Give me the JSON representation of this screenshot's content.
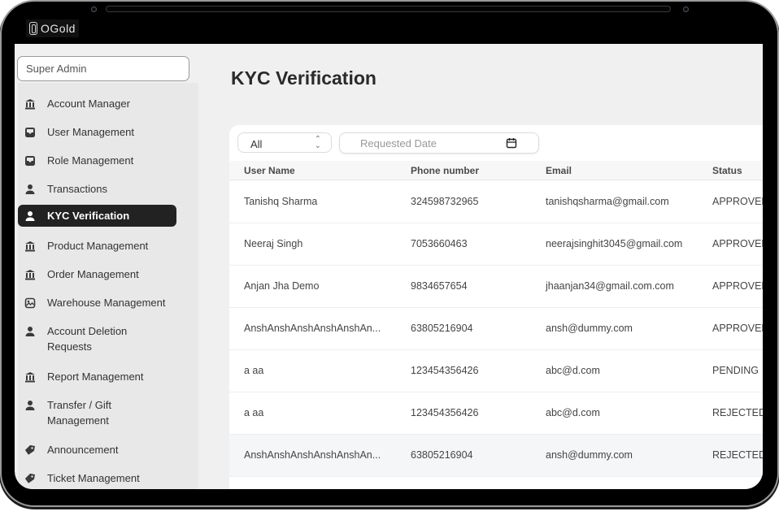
{
  "app": {
    "brand": "OGold",
    "role": "Super Admin"
  },
  "sidebar": {
    "items": [
      {
        "label": "Account Manager",
        "icon": "bank-icon"
      },
      {
        "label": "User Management",
        "icon": "inbox-icon"
      },
      {
        "label": "Role Management",
        "icon": "inbox-icon"
      },
      {
        "label": "Transactions",
        "icon": "person-icon"
      },
      {
        "label": "KYC Verification",
        "icon": "person-icon",
        "active": true
      },
      {
        "label": "Product Management",
        "icon": "bank-icon"
      },
      {
        "label": "Order Management",
        "icon": "bank-icon"
      },
      {
        "label": "Warehouse Management",
        "icon": "image-icon"
      },
      {
        "label": "Account Deletion Requests",
        "icon": "person-icon"
      },
      {
        "label": "Report Management",
        "icon": "bank-icon"
      },
      {
        "label": "Transfer / Gift Management",
        "icon": "person-icon"
      },
      {
        "label": "Announcement",
        "icon": "tag-icon"
      },
      {
        "label": "Ticket Management",
        "icon": "tag-icon"
      }
    ]
  },
  "main": {
    "title": "KYC Verification",
    "filters": {
      "status_selected": "All",
      "date_placeholder": "Requested Date"
    },
    "table": {
      "columns": [
        "User Name",
        "Phone number",
        "Email",
        "Status"
      ],
      "rows": [
        {
          "name": "Tanishq Sharma",
          "phone": "324598732965",
          "email": "tanishqsharma@gmail.com",
          "status": "APPROVED"
        },
        {
          "name": "Neeraj Singh",
          "phone": "7053660463",
          "email": "neerajsinghit3045@gmail.com",
          "status": "APPROVED"
        },
        {
          "name": "Anjan Jha Demo",
          "phone": "9834657654",
          "email": "jhaanjan34@gmail.com.com",
          "status": "APPROVED"
        },
        {
          "name": "AnshAnshAnshAnshAnshAn...",
          "phone": "63805216904",
          "email": "ansh@dummy.com",
          "status": "APPROVED"
        },
        {
          "name": "a aa",
          "phone": "123454356426",
          "email": "abc@d.com",
          "status": "PENDING"
        },
        {
          "name": "a aa",
          "phone": "123454356426",
          "email": "abc@d.com",
          "status": "REJECTED"
        },
        {
          "name": "AnshAnshAnshAnshAnshAn...",
          "phone": "63805216904",
          "email": "ansh@dummy.com",
          "status": "REJECTED"
        }
      ]
    }
  }
}
